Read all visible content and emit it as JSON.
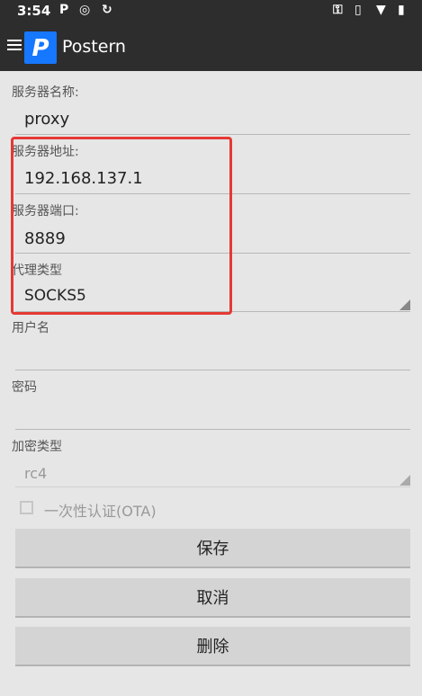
{
  "status_bar": {
    "time": "3:54",
    "icons": [
      "p-notification-icon",
      "chrome-icon",
      "sync-icon",
      "key-icon",
      "vibrate-icon",
      "wifi-icon",
      "battery-icon"
    ]
  },
  "app_bar": {
    "title": "Postern",
    "logo_letter": "P"
  },
  "form": {
    "server_name": {
      "label": "服务器名称:",
      "value": "proxy"
    },
    "server_address": {
      "label": "服务器地址:",
      "value": "192.168.137.1"
    },
    "server_port": {
      "label": "服务器端口:",
      "value": "8889"
    },
    "proxy_type": {
      "label": "代理类型",
      "value": "SOCKS5"
    },
    "username": {
      "label": "用户名",
      "value": ""
    },
    "password": {
      "label": "密码",
      "value": ""
    },
    "encryption_type": {
      "label": "加密类型",
      "value": "rc4"
    },
    "ota": {
      "label": "一次性认证(OTA)",
      "checked": false
    }
  },
  "buttons": {
    "save": "保存",
    "cancel": "取消",
    "delete": "删除"
  },
  "colors": {
    "highlight": "#e53935",
    "logo": "#1677ff",
    "toolbar": "#2d2d2d"
  }
}
